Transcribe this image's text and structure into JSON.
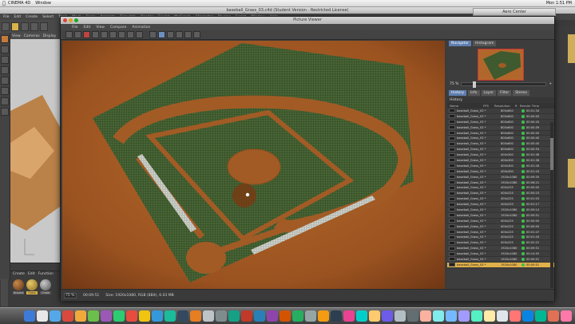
{
  "macbar": {
    "items": [
      "CINEMA 4D",
      "Window"
    ],
    "right": [
      "Mon 1:51 PM"
    ]
  },
  "c4d": {
    "title": "baseball_Grass_03.c4d (Student Version - Restricted License)",
    "menu": [
      "File",
      "Edit",
      "Create",
      "Select",
      "Tools",
      "Mesh",
      "Snap",
      "Animate",
      "Simulate",
      "Render",
      "Sculpt",
      "MoGraph",
      "Character",
      "Plugins",
      "Script",
      "Window",
      "Help"
    ],
    "view_menu": [
      "View",
      "Cameras",
      "Display"
    ],
    "material_menu": [
      "Create",
      "Edit",
      "Function"
    ],
    "materials": [
      {
        "label": "Ground",
        "color": "#8a5a2a"
      },
      {
        "label": "Grass",
        "color": "#d9b24a"
      },
      {
        "label": "Chalk",
        "color": "#9a9a9a"
      }
    ],
    "status": "Azimuth: 162.2°, Altitude: -58.0°",
    "bottom_fields": [
      "Object (Rel)",
      "Size",
      "Apply"
    ]
  },
  "aero_center": {
    "title": "Aero Center"
  },
  "picture_viewer": {
    "title": "Picture Viewer",
    "menu": [
      "File",
      "Edit",
      "View",
      "Compare",
      "Animation"
    ],
    "status_zoom": "75 %",
    "status_time": "00:09:51",
    "status_info": "Size: 1920x1080, RGB (8Bit), 6.03 MB",
    "navigator_tabs": [
      "Navigator",
      "Histogram"
    ],
    "zoom_value": "75 %",
    "history_tabs": [
      "History",
      "Info",
      "Layer",
      "Filter",
      "Stereo"
    ],
    "history_heading": "History",
    "history_columns": [
      "Name",
      "FPS",
      "Resolution",
      "R",
      "Render Time"
    ],
    "history_rows": [
      {
        "name": "baseball_Grass_03 *",
        "res": "800x600",
        "time": "00:01:34"
      },
      {
        "name": "baseball_Grass_03 *",
        "res": "800x600",
        "time": "00:00:00"
      },
      {
        "name": "baseball_Grass_03 *",
        "res": "800x600",
        "time": "00:00:43"
      },
      {
        "name": "baseball_Grass_03 *",
        "res": "800x600",
        "time": "00:00:39"
      },
      {
        "name": "baseball_Grass_03 *",
        "res": "800x600",
        "time": "00:00:00"
      },
      {
        "name": "baseball_Grass_03 *",
        "res": "800x600",
        "time": "00:00:40"
      },
      {
        "name": "baseball_Grass_03 *",
        "res": "800x600",
        "time": "00:00:40"
      },
      {
        "name": "baseball_Grass_03 *",
        "res": "800x600",
        "time": "00:00:54"
      },
      {
        "name": "baseball_Grass_03 *",
        "res": "400x300",
        "time": "00:01:36"
      },
      {
        "name": "baseball_Grass_03 *",
        "res": "400x300",
        "time": "00:01:38"
      },
      {
        "name": "baseball_Grass_03 *",
        "res": "400x300",
        "time": "00:01:26"
      },
      {
        "name": "baseball_Grass_03 *",
        "res": "400x300",
        "time": "00:01:24"
      },
      {
        "name": "baseball_Grass_03 *",
        "res": "1920x1080",
        "time": "00:09:35"
      },
      {
        "name": "baseball_Grass_03 *",
        "res": "1920x1080",
        "time": "00:06:21"
      },
      {
        "name": "baseball_Grass_03 *",
        "res": "400x225",
        "time": "00:00:00"
      },
      {
        "name": "baseball_Grass_03 *",
        "res": "400x225",
        "time": "00:00:23"
      },
      {
        "name": "baseball_Grass_03 *",
        "res": "400x225",
        "time": "00:01:03"
      },
      {
        "name": "baseball_Grass_03 *",
        "res": "400x225",
        "time": "00:01:17"
      },
      {
        "name": "baseball_Grass_03 *",
        "res": "1920x1080",
        "time": "00:09:14"
      },
      {
        "name": "baseball_Grass_03 *",
        "res": "1920x1080",
        "time": "00:09:51"
      },
      {
        "name": "baseball_Grass_03 *",
        "res": "400x225",
        "time": "00:00:00"
      },
      {
        "name": "baseball_Grass_03 *",
        "res": "400x225",
        "time": "00:00:00"
      },
      {
        "name": "baseball_Grass_03 *",
        "res": "400x225",
        "time": "00:01:47"
      },
      {
        "name": "baseball_Grass_03 *",
        "res": "400x225",
        "time": "00:01:43"
      },
      {
        "name": "baseball_Grass_03 *",
        "res": "400x225",
        "time": "00:02:22"
      },
      {
        "name": "baseball_Grass_03 *",
        "res": "1920x1080",
        "time": "00:09:51"
      },
      {
        "name": "baseball_Grass_03 *",
        "res": "1920x1080",
        "time": "00:14:55"
      },
      {
        "name": "baseball_Grass_03 *",
        "res": "1920x1080",
        "time": "00:09:51"
      },
      {
        "name": "baseball_Grass_03 *",
        "res": "1920x1080",
        "time": "00:09:51"
      }
    ],
    "selected_row": 28
  },
  "colors": {
    "accent_blue": "#5f7fb0",
    "selected_yellow": "#e0b04a",
    "render_ok_green": "#3ac24a",
    "field_orange": "#b1672b",
    "grass_green": "#3e5a2e"
  }
}
